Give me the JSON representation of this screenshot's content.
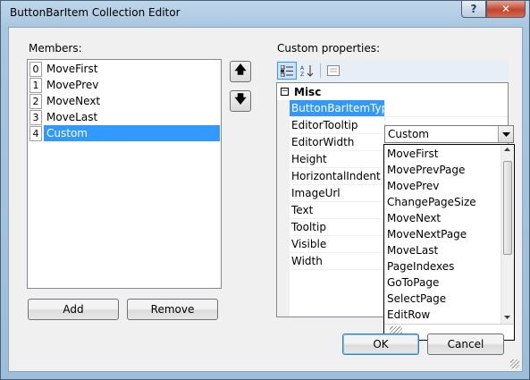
{
  "window": {
    "title": "ButtonBarItem Collection Editor",
    "help_label": "?",
    "close_label": "✕"
  },
  "members": {
    "label": "Members:",
    "items": [
      {
        "index": "0",
        "name": "MoveFirst"
      },
      {
        "index": "1",
        "name": "MovePrev"
      },
      {
        "index": "2",
        "name": "MoveNext"
      },
      {
        "index": "3",
        "name": "MoveLast"
      },
      {
        "index": "4",
        "name": "Custom"
      }
    ],
    "selected_index": 4,
    "move_up_icon": "🡅",
    "move_down_icon": "🡇"
  },
  "buttons": {
    "add": "Add",
    "remove": "Remove",
    "ok": "OK",
    "cancel": "Cancel"
  },
  "properties": {
    "label": "Custom properties:",
    "category": "Misc",
    "collapse_glyph": "−",
    "rows": [
      {
        "name": "ButtonBarItemType"
      },
      {
        "name": "EditorTooltip"
      },
      {
        "name": "EditorWidth"
      },
      {
        "name": "Height"
      },
      {
        "name": "HorizontalIndent"
      },
      {
        "name": "ImageUrl"
      },
      {
        "name": "Text"
      },
      {
        "name": "Tooltip"
      },
      {
        "name": "Visible"
      },
      {
        "name": "Width"
      }
    ],
    "selected_row": "ButtonBarItemType",
    "selected_value": "Custom"
  },
  "dropdown": {
    "options": [
      "MoveFirst",
      "MovePrevPage",
      "MovePrev",
      "ChangePageSize",
      "MoveNext",
      "MoveNextPage",
      "MoveLast",
      "PageIndexes",
      "GoToPage",
      "SelectPage",
      "EditRow"
    ]
  },
  "colors": {
    "selection": "#3399ff",
    "title_bar": "#a9c6e0",
    "close_button": "#c1452d"
  }
}
